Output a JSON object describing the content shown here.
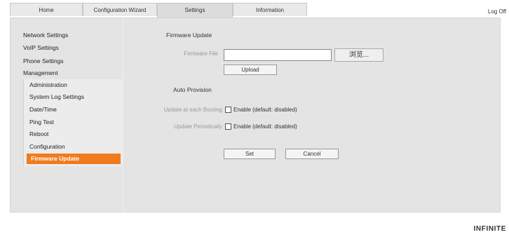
{
  "tabs": [
    {
      "label": "Home"
    },
    {
      "label": "Configuration Wizard"
    },
    {
      "label": "Settings"
    },
    {
      "label": "Information"
    }
  ],
  "header": {
    "logoff": "Log Off"
  },
  "sidebar": {
    "items": [
      {
        "label": "Network Settings"
      },
      {
        "label": "VoIP Settings"
      },
      {
        "label": "Phone Settings"
      },
      {
        "label": "Management"
      }
    ],
    "submenu": [
      {
        "label": "Administration"
      },
      {
        "label": "System Log Settings"
      },
      {
        "label": "Date/Time"
      },
      {
        "label": "Ping Test"
      },
      {
        "label": "Reboot"
      },
      {
        "label": "Configuration"
      },
      {
        "label": "Firmware Update"
      }
    ],
    "selected": "Firmware Update"
  },
  "main": {
    "firmware_update": {
      "title": "Firmware Update",
      "file_label": "Firmware File",
      "file_value": "",
      "browse_label": "浏览...",
      "upload_label": "Upload"
    },
    "auto_provision": {
      "title": "Auto Provision",
      "boot_label": "Update at each Booting",
      "boot_option": "Enable (default: disabled)",
      "periodic_label": "Update Periodically",
      "periodic_option": "Enable (default: disabled)"
    },
    "set_label": "Set",
    "cancel_label": "Cancel"
  },
  "footer": {
    "brand": "INFINITE"
  },
  "colors": {
    "accent": "#f07b1e",
    "panel": "#e4e4e4"
  }
}
